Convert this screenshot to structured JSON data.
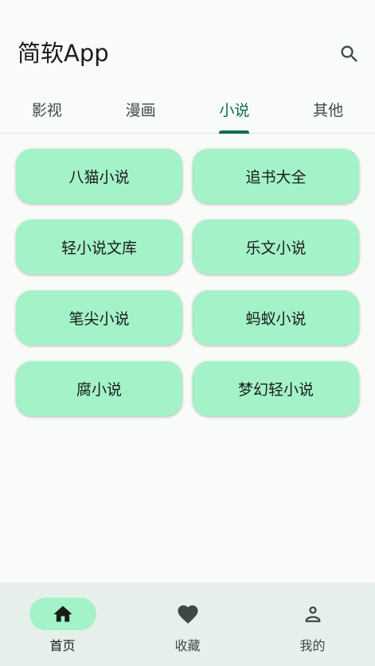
{
  "app": {
    "title": "简软App"
  },
  "tabs": [
    {
      "label": "影视"
    },
    {
      "label": "漫画"
    },
    {
      "label": "小说"
    },
    {
      "label": "其他"
    }
  ],
  "active_tab": "小说",
  "sources": [
    {
      "label": "八猫小说"
    },
    {
      "label": "追书大全"
    },
    {
      "label": "轻小说文库"
    },
    {
      "label": "乐文小说"
    },
    {
      "label": "笔尖小说"
    },
    {
      "label": "蚂蚁小说"
    },
    {
      "label": "腐小说"
    },
    {
      "label": "梦幻轻小说"
    }
  ],
  "bottom_nav": [
    {
      "label": "首页",
      "icon": "home-icon"
    },
    {
      "label": "收藏",
      "icon": "heart-icon"
    },
    {
      "label": "我的",
      "icon": "person-icon"
    }
  ],
  "active_nav": "首页",
  "colors": {
    "accent": "#0e6b50",
    "card": "#a3f2c8",
    "background": "#f8fbf7",
    "nav_background": "#e6efe9"
  }
}
